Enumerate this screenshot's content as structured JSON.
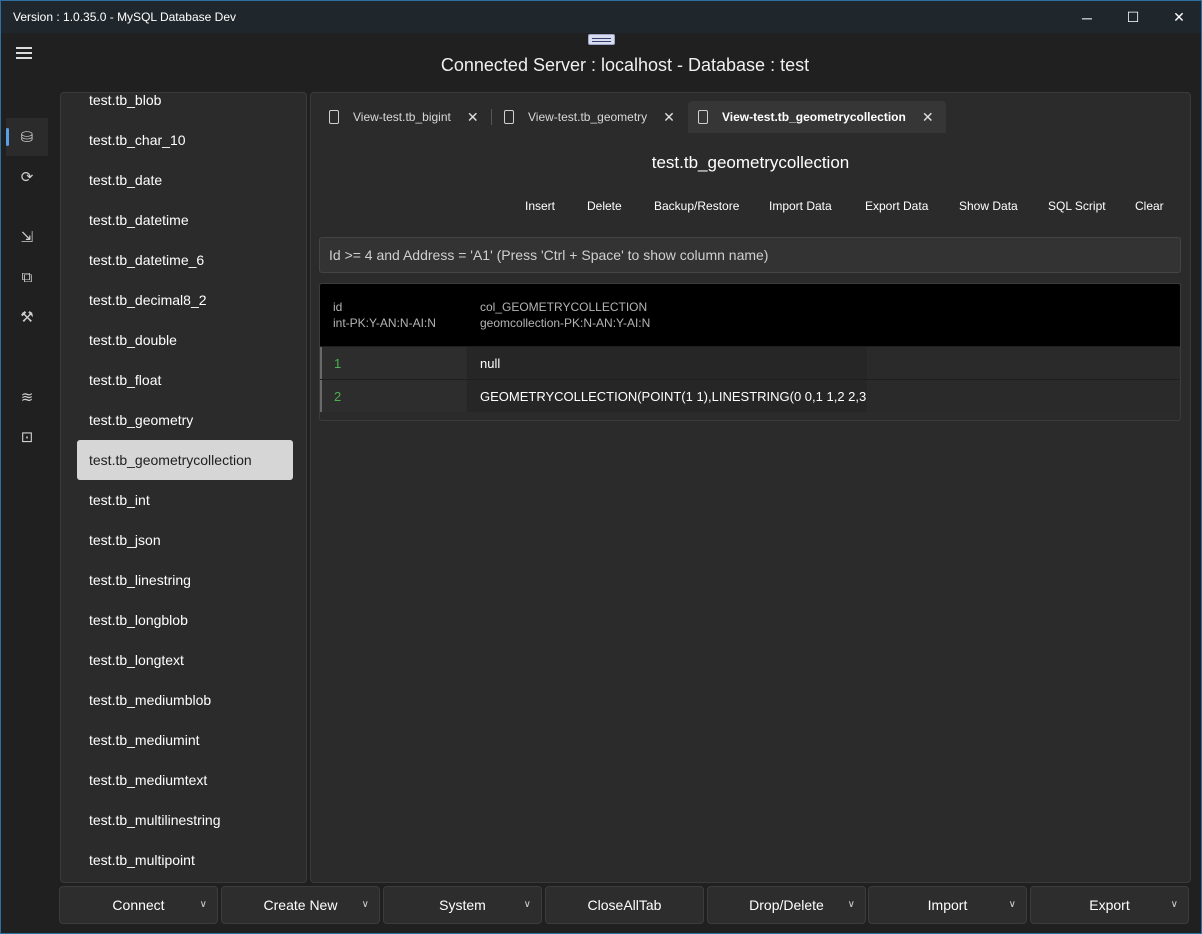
{
  "window": {
    "title": "Version : 1.0.35.0 - MySQL Database Dev",
    "min_glyph": "─",
    "max_glyph": "☐",
    "close_glyph": "✕"
  },
  "header": {
    "title": "Connected Server : localhost - Database : test"
  },
  "rail": {
    "icons": [
      "database-icon",
      "refresh-db-icon",
      "export-doc-icon",
      "compare-icon",
      "tools-icon",
      "wifi-icon",
      "settings-icon"
    ],
    "glyphs": [
      "⛁",
      "⟳",
      "⇲",
      "⧉",
      "⚒",
      "≋",
      "⊡"
    ]
  },
  "tables": [
    "test.tb_blob",
    "test.tb_char_10",
    "test.tb_date",
    "test.tb_datetime",
    "test.tb_datetime_6",
    "test.tb_decimal8_2",
    "test.tb_double",
    "test.tb_float",
    "test.tb_geometry",
    "test.tb_geometrycollection",
    "test.tb_int",
    "test.tb_json",
    "test.tb_linestring",
    "test.tb_longblob",
    "test.tb_longtext",
    "test.tb_mediumblob",
    "test.tb_mediumint",
    "test.tb_mediumtext",
    "test.tb_multilinestring",
    "test.tb_multipoint"
  ],
  "selected_table": "test.tb_geometrycollection",
  "tabs": [
    {
      "label": "View-test.tb_bigint",
      "close": "✕"
    },
    {
      "label": "View-test.tb_geometry",
      "close": "✕"
    },
    {
      "label": "View-test.tb_geometrycollection",
      "close": "✕"
    }
  ],
  "view": {
    "title": "test.tb_geometrycollection",
    "actions": [
      "Insert",
      "Delete",
      "Backup/Restore",
      "Import Data",
      "Export Data",
      "Show Data",
      "SQL Script",
      "Clear"
    ],
    "filter_placeholder": "Id >= 4 and Address = 'A1' (Press 'Ctrl + Space' to show column name)"
  },
  "grid": {
    "columns": [
      {
        "name": "id",
        "type": "int-PK:Y-AN:N-AI:N"
      },
      {
        "name": "col_GEOMETRYCOLLECTION",
        "type": "geomcollection-PK:N-AN:Y-AI:N"
      }
    ],
    "rows": [
      {
        "id": "1",
        "value": "null"
      },
      {
        "id": "2",
        "value": "GEOMETRYCOLLECTION(POINT(1 1),LINESTRING(0 0,1 1,2 2,3"
      }
    ]
  },
  "bottom_buttons": [
    {
      "label": "Connect",
      "dropdown": true
    },
    {
      "label": "Create New",
      "dropdown": true
    },
    {
      "label": "System",
      "dropdown": true
    },
    {
      "label": "CloseAllTab",
      "dropdown": false
    },
    {
      "label": "Drop/Delete",
      "dropdown": true
    },
    {
      "label": "Import",
      "dropdown": true
    },
    {
      "label": "Export",
      "dropdown": true
    }
  ],
  "chevron_glyph": "∨",
  "colors": {
    "background": "#202020",
    "panel": "#2b2b2b",
    "accent": "#5aa0e6",
    "id_text": "#4caf50"
  }
}
